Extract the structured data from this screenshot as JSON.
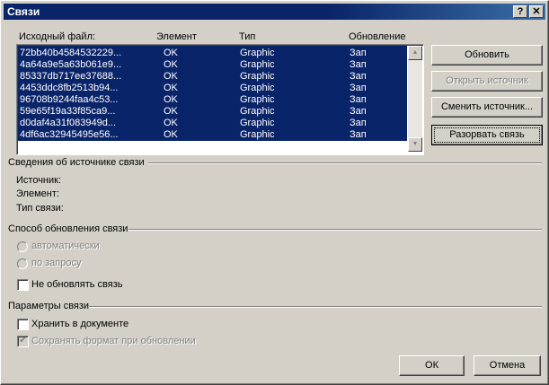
{
  "window": {
    "title": "Связи",
    "help_label": "?",
    "close_label": "✕"
  },
  "list": {
    "headers": {
      "source": "Исходный файл:",
      "element": "Элемент",
      "type": "Тип",
      "update": "Обновление"
    },
    "rows": [
      {
        "source": "72bb40b4584532229...",
        "element": "OK",
        "type": "Graphic",
        "update": "Зап"
      },
      {
        "source": "4a64a9e5a63b061e9...",
        "element": "OK",
        "type": "Graphic",
        "update": "Зап"
      },
      {
        "source": "85337db717ee37688...",
        "element": "OK",
        "type": "Graphic",
        "update": "Зап"
      },
      {
        "source": "4453ddc8fb2513b94...",
        "element": "OK",
        "type": "Graphic",
        "update": "Зап"
      },
      {
        "source": "96708b9244faa4c53...",
        "element": "OK",
        "type": "Graphic",
        "update": "Зап"
      },
      {
        "source": "59e65f19a33f85ca9...",
        "element": "OK",
        "type": "Graphic",
        "update": "Зап"
      },
      {
        "source": "d0daf4a31f083949d...",
        "element": "OK",
        "type": "Graphic",
        "update": "Зап"
      },
      {
        "source": "4df6ac32945495e56...",
        "element": "OK",
        "type": "Graphic",
        "update": "Зап"
      }
    ],
    "scroll_up_icon": "triangle-up-icon",
    "scroll_down_icon": "triangle-down-icon"
  },
  "buttons": {
    "refresh": "Обновить",
    "open_source": "Открыть источник",
    "change_source": "Сменить источник...",
    "break_link": "Разорвать связь",
    "ok": "ОК",
    "cancel": "Отмена"
  },
  "source_info": {
    "heading": "Сведения об источнике связи",
    "source_label": "Источник:",
    "element_label": "Элемент:",
    "link_type_label": "Тип связи:"
  },
  "update_method": {
    "heading": "Способ обновления связи",
    "automatic": "автоматически",
    "on_request": "по запросу",
    "no_update": "Не обновлять связь",
    "no_update_checked": false
  },
  "link_params": {
    "heading": "Параметры связи",
    "store_in_doc": "Хранить в документе",
    "store_in_doc_checked": false,
    "keep_format": "Сохранять формат при обновлении",
    "keep_format_checked": true
  },
  "colors": {
    "selection": "#0a246a",
    "titlebar": "#0a246a",
    "face": "#d4d0c8"
  }
}
